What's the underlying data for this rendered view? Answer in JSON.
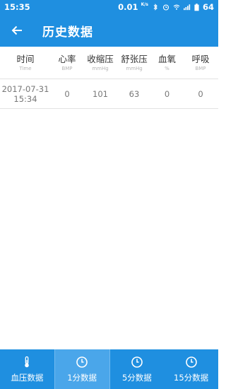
{
  "status_bar": {
    "time": "15:35",
    "net_speed": "0.01",
    "net_unit": "K/s",
    "battery": "64"
  },
  "header": {
    "title": "历史数据",
    "back_icon": "arrow-left-icon"
  },
  "table": {
    "columns": [
      {
        "label": "时间",
        "unit": "Time"
      },
      {
        "label": "心率",
        "unit": "BMP"
      },
      {
        "label": "收缩压",
        "unit": "mmHg"
      },
      {
        "label": "舒张压",
        "unit": "mmHg"
      },
      {
        "label": "血氧",
        "unit": "%"
      },
      {
        "label": "呼吸",
        "unit": "BMP"
      }
    ],
    "rows": [
      {
        "date": "2017-07-31",
        "time": "15:34",
        "heart_rate": "0",
        "systolic": "101",
        "diastolic": "63",
        "oxygen": "0",
        "breath": "0"
      }
    ]
  },
  "tabs": [
    {
      "label": "血压数据",
      "icon": "thermometer-icon",
      "active": false
    },
    {
      "label": "1分数据",
      "icon": "clock-icon",
      "active": true
    },
    {
      "label": "5分数据",
      "icon": "clock-icon",
      "active": false
    },
    {
      "label": "15分数据",
      "icon": "clock-icon",
      "active": false
    }
  ],
  "colors": {
    "primary": "#1f8fe0",
    "tab_active": "#4aa6ea"
  }
}
